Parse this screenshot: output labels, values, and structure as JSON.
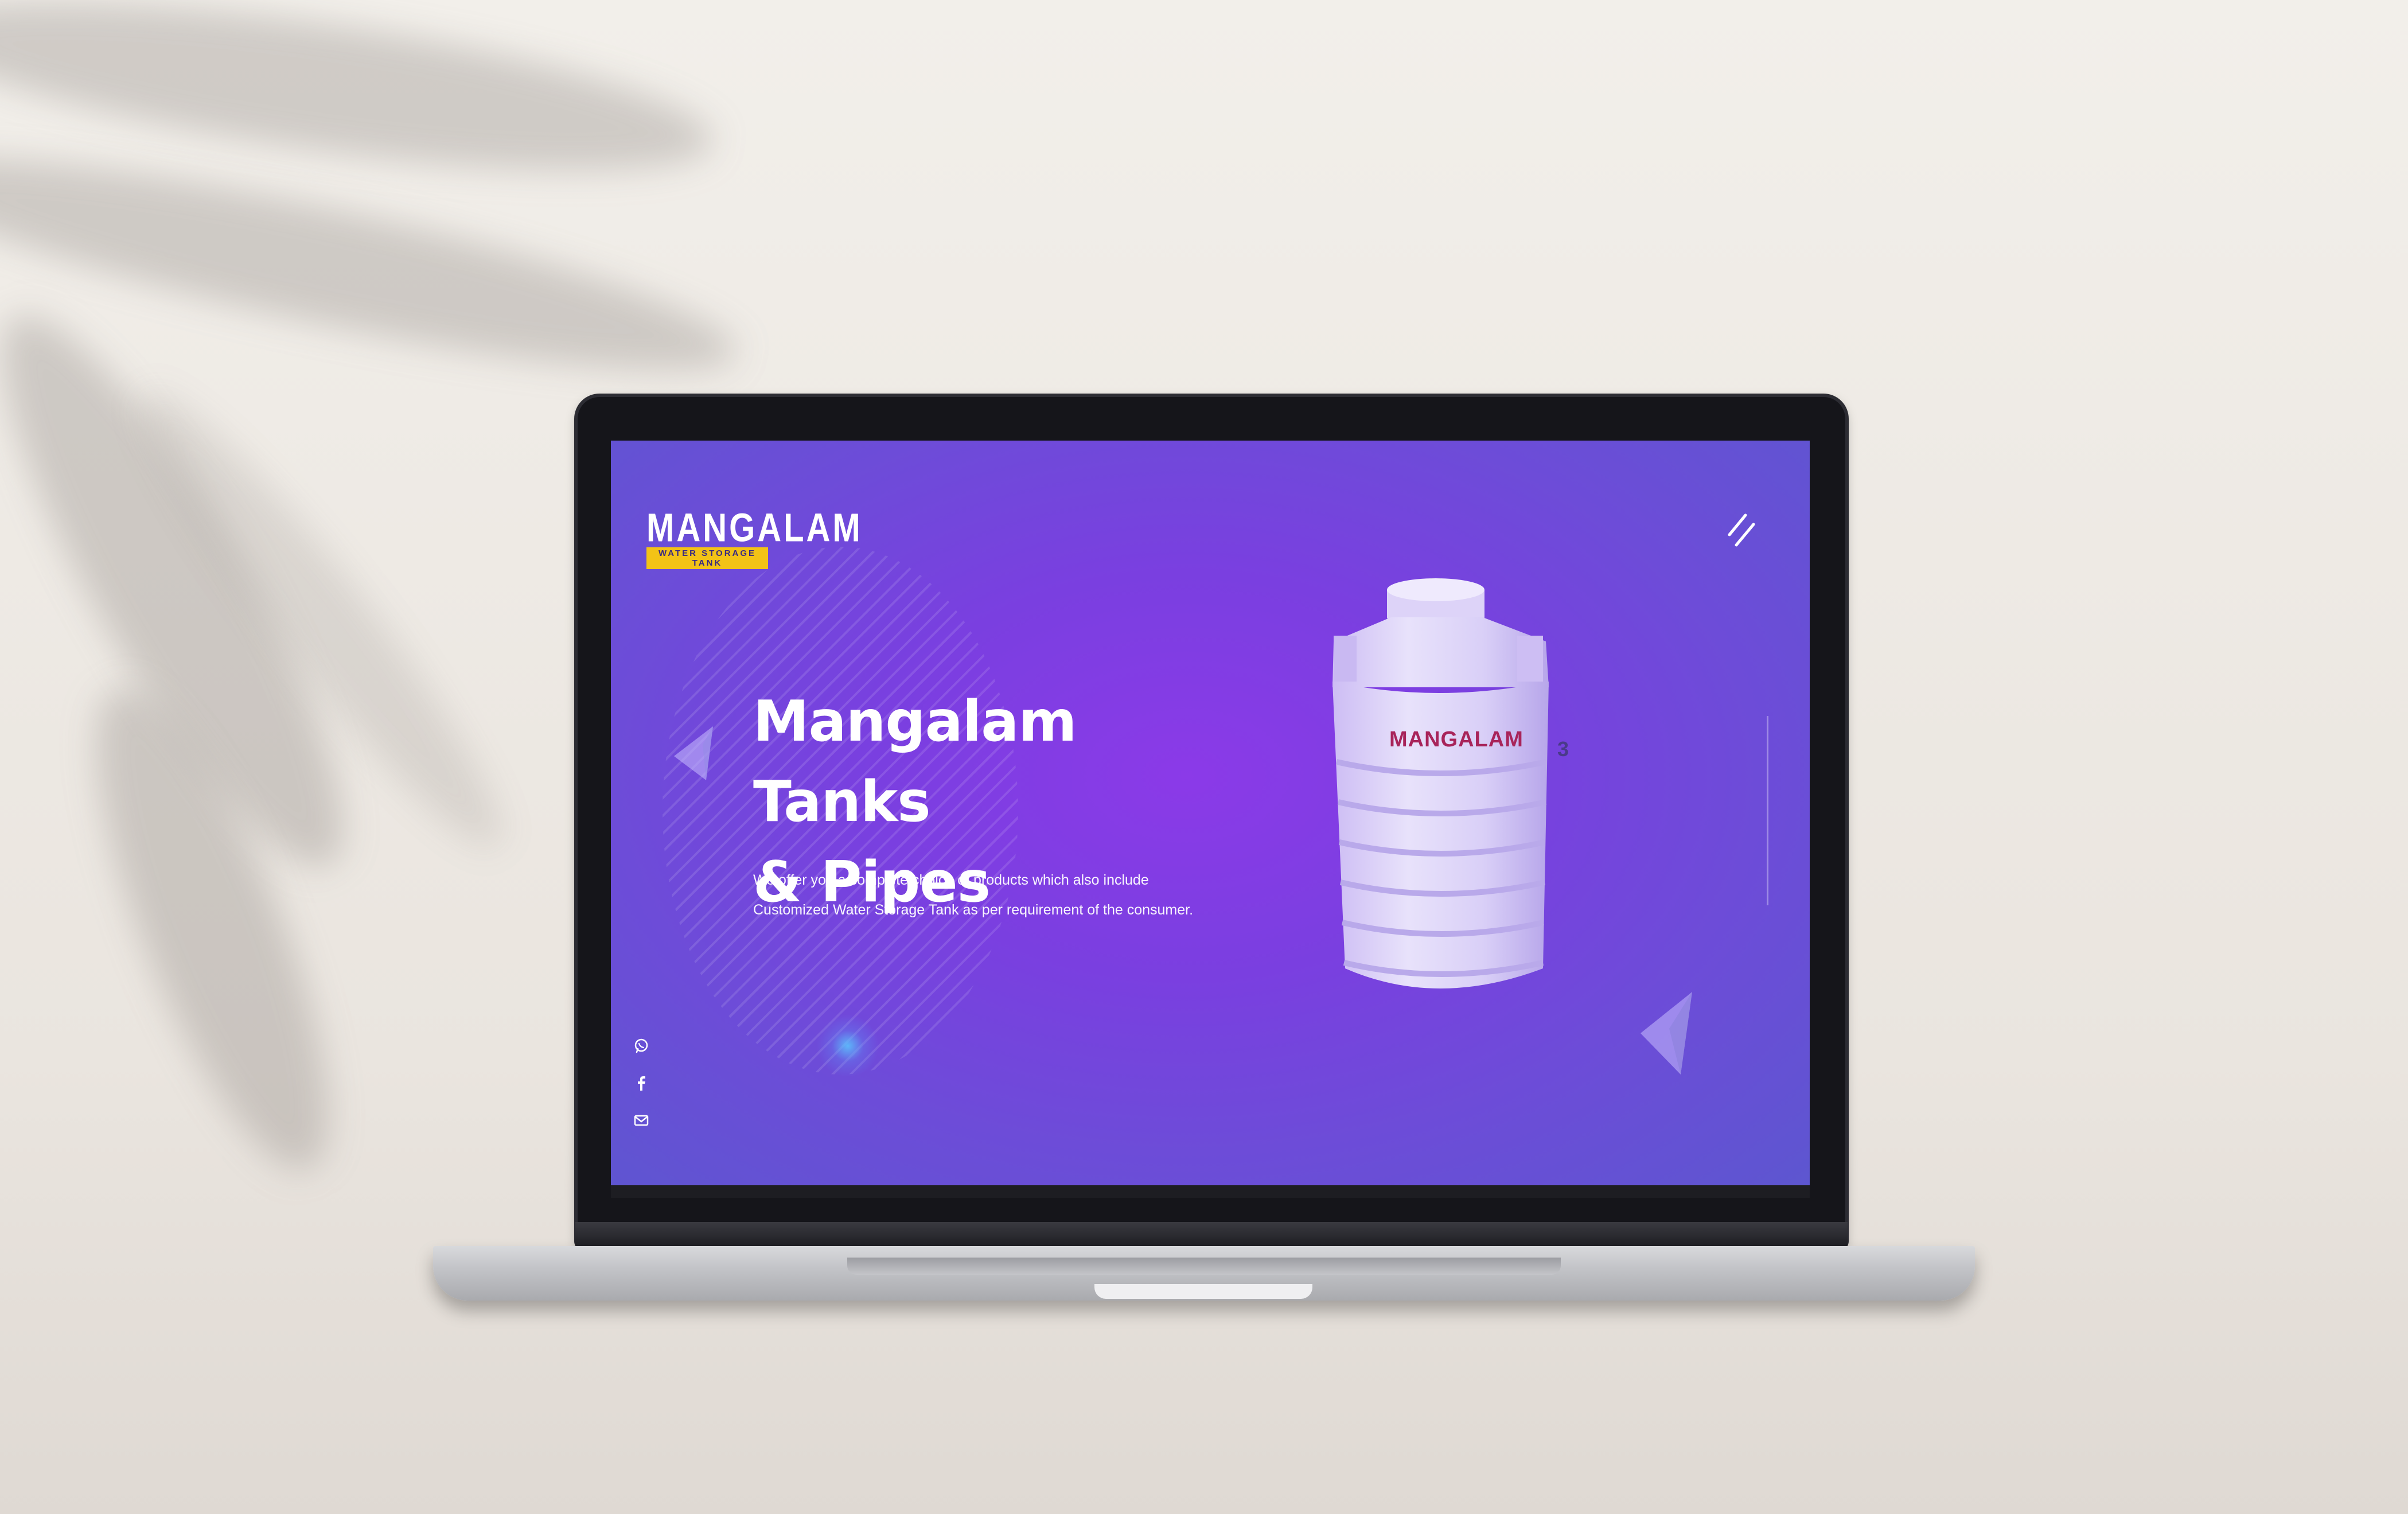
{
  "brand": {
    "name": "MANGALAM",
    "tagline": "WATER STORAGE TANK",
    "accent_color": "#f3c316"
  },
  "hero": {
    "title_line1": "Mangalam Tanks",
    "title_line2": "& Pipes",
    "description_line1": "We offer you a complete choice of products which also include",
    "description_line2": "Customized Water Storage Tank as per requirement of the consumer."
  },
  "product": {
    "tank_label": "MANGALAM",
    "side_mark": "3"
  },
  "nav": {
    "menu_icon": "hamburger-slash-icon"
  },
  "social": [
    {
      "icon": "whatsapp-icon"
    },
    {
      "icon": "facebook-icon"
    },
    {
      "icon": "mail-icon"
    }
  ],
  "colors": {
    "hero_gradient_center": "#8b3ae8",
    "hero_gradient_edge": "#5d56d0",
    "text": "#ffffff",
    "tank_label": "#a8245a"
  }
}
